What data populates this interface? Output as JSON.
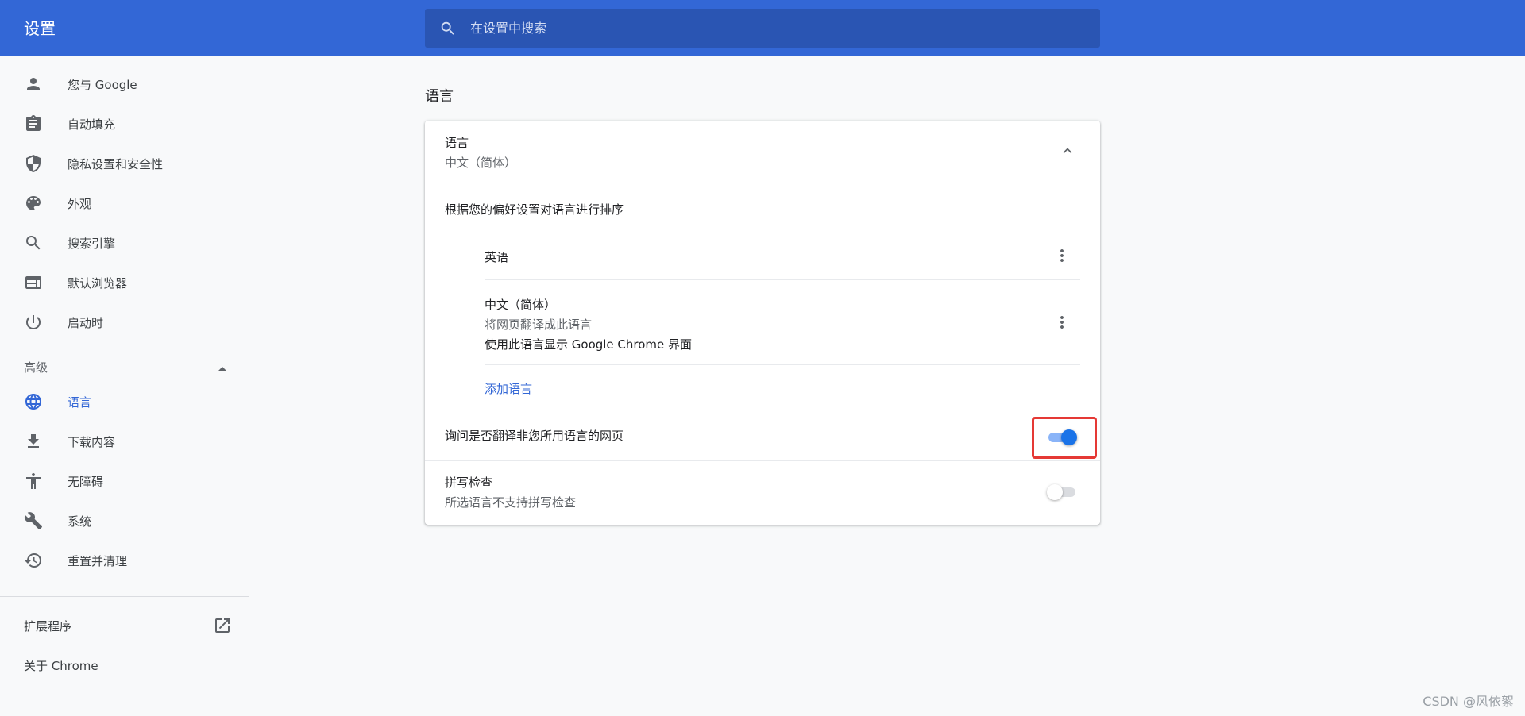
{
  "header": {
    "title": "设置",
    "search_placeholder": "在设置中搜索",
    "search_value": ""
  },
  "sidebar": {
    "items": [
      {
        "label": "您与 Google",
        "icon": "person-icon"
      },
      {
        "label": "自动填充",
        "icon": "clipboard-icon"
      },
      {
        "label": "隐私设置和安全性",
        "icon": "shield-icon"
      },
      {
        "label": "外观",
        "icon": "palette-icon"
      },
      {
        "label": "搜索引擎",
        "icon": "search-icon"
      },
      {
        "label": "默认浏览器",
        "icon": "browser-icon"
      },
      {
        "label": "启动时",
        "icon": "power-icon"
      }
    ],
    "advanced": {
      "label": "高级",
      "expanded": true,
      "items": [
        {
          "label": "语言",
          "icon": "globe-icon",
          "active": true
        },
        {
          "label": "下载内容",
          "icon": "download-icon"
        },
        {
          "label": "无障碍",
          "icon": "accessibility-icon"
        },
        {
          "label": "系统",
          "icon": "wrench-icon"
        },
        {
          "label": "重置并清理",
          "icon": "history-icon"
        }
      ]
    },
    "extensions_label": "扩展程序",
    "about_label": "关于 Chrome"
  },
  "main": {
    "section_title": "语言",
    "language_card": {
      "header_title": "语言",
      "header_value": "中文（简体）",
      "order_text": "根据您的偏好设置对语言进行排序",
      "languages": [
        {
          "name": "英语"
        },
        {
          "name": "中文（简体）",
          "note1": "将网页翻译成此语言",
          "note2": "使用此语言显示 Google Chrome 界面"
        }
      ],
      "add_language": "添加语言",
      "ask_translate_label": "询问是否翻译非您所用语言的网页",
      "ask_translate_enabled": true,
      "spellcheck_title": "拼写检查",
      "spellcheck_sub": "所选语言不支持拼写检查",
      "spellcheck_enabled": false
    }
  },
  "colors": {
    "accent": "#3367d6",
    "header_bg": "#3367d6",
    "toggle_on_knob": "#1a73e8",
    "toggle_on_track": "#8ab4f8",
    "highlight": "#e53935"
  },
  "watermark": "CSDN @风依絮"
}
